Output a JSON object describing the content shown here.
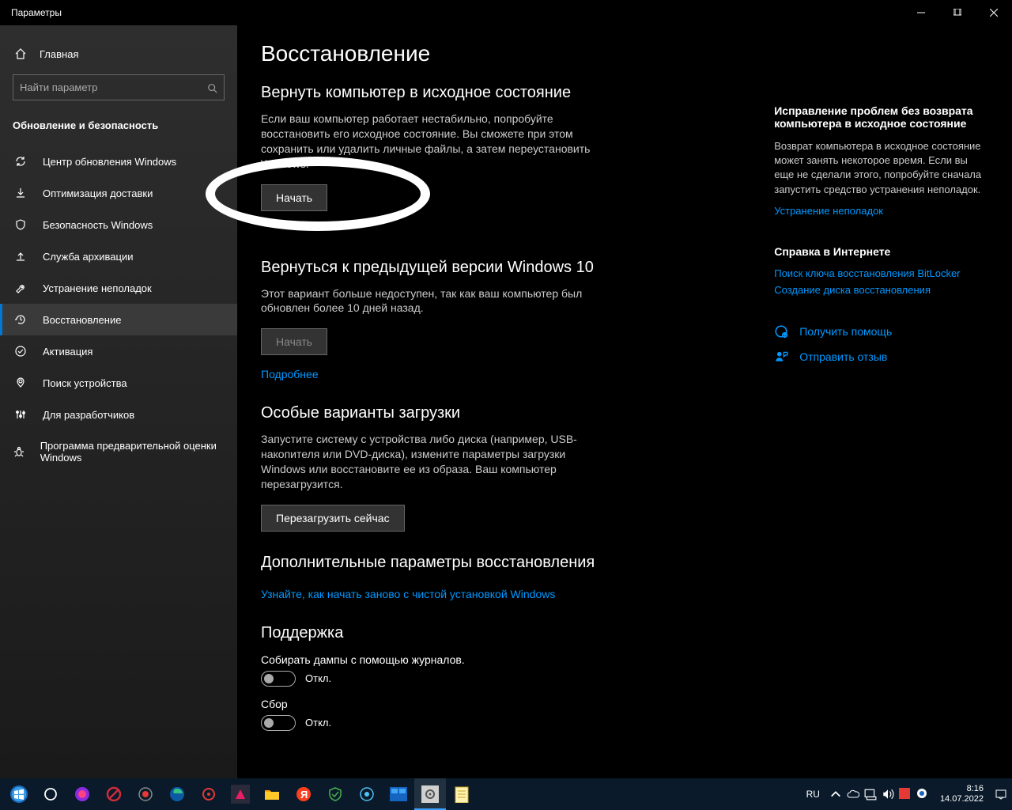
{
  "window": {
    "title": "Параметры"
  },
  "sidebar": {
    "home": "Главная",
    "search_placeholder": "Найти параметр",
    "section": "Обновление и безопасность",
    "items": [
      {
        "label": "Центр обновления Windows"
      },
      {
        "label": "Оптимизация доставки"
      },
      {
        "label": "Безопасность Windows"
      },
      {
        "label": "Служба архивации"
      },
      {
        "label": "Устранение неполадок"
      },
      {
        "label": "Восстановление"
      },
      {
        "label": "Активация"
      },
      {
        "label": "Поиск устройства"
      },
      {
        "label": "Для разработчиков"
      },
      {
        "label": "Программа предварительной оценки Windows"
      }
    ]
  },
  "page": {
    "title": "Восстановление",
    "reset": {
      "heading": "Вернуть компьютер в исходное состояние",
      "body": "Если ваш компьютер работает нестабильно, попробуйте восстановить его исходное состояние. Вы сможете при этом сохранить или удалить личные файлы, а затем переустановить Windows.",
      "button": "Начать"
    },
    "goback": {
      "heading": "Вернуться к предыдущей версии Windows 10",
      "body": "Этот вариант больше недоступен, так как ваш компьютер был обновлен более 10 дней назад.",
      "button": "Начать",
      "link": "Подробнее"
    },
    "advanced": {
      "heading": "Особые варианты загрузки",
      "body": "Запустите систему с устройства либо диска (например, USB-накопителя или DVD-диска), измените параметры загрузки Windows или восстановите ее из образа. Ваш компьютер перезагрузится.",
      "button": "Перезагрузить сейчас"
    },
    "more": {
      "heading": "Дополнительные параметры восстановления",
      "link": "Узнайте, как начать заново с чистой установкой Windows"
    },
    "support": {
      "heading": "Поддержка",
      "dump_label": "Собирать дампы с помощью журналов.",
      "off1": "Откл.",
      "collect_label": "Сбор",
      "off2": "Откл."
    }
  },
  "aside": {
    "fix": {
      "heading": "Исправление проблем без возврата компьютера в исходное состояние",
      "body": "Возврат компьютера в исходное состояние может занять некоторое время. Если вы еще не сделали этого, попробуйте сначала запустить средство устранения неполадок.",
      "link": "Устранение неполадок"
    },
    "help": {
      "heading": "Справка в Интернете",
      "link1": "Поиск ключа восстановления BitLocker",
      "link2": "Создание диска восстановления"
    },
    "actions": {
      "help": "Получить помощь",
      "feedback": "Отправить отзыв"
    }
  },
  "tray": {
    "lang": "RU",
    "time": "8:16",
    "date": "14.07.2022"
  }
}
